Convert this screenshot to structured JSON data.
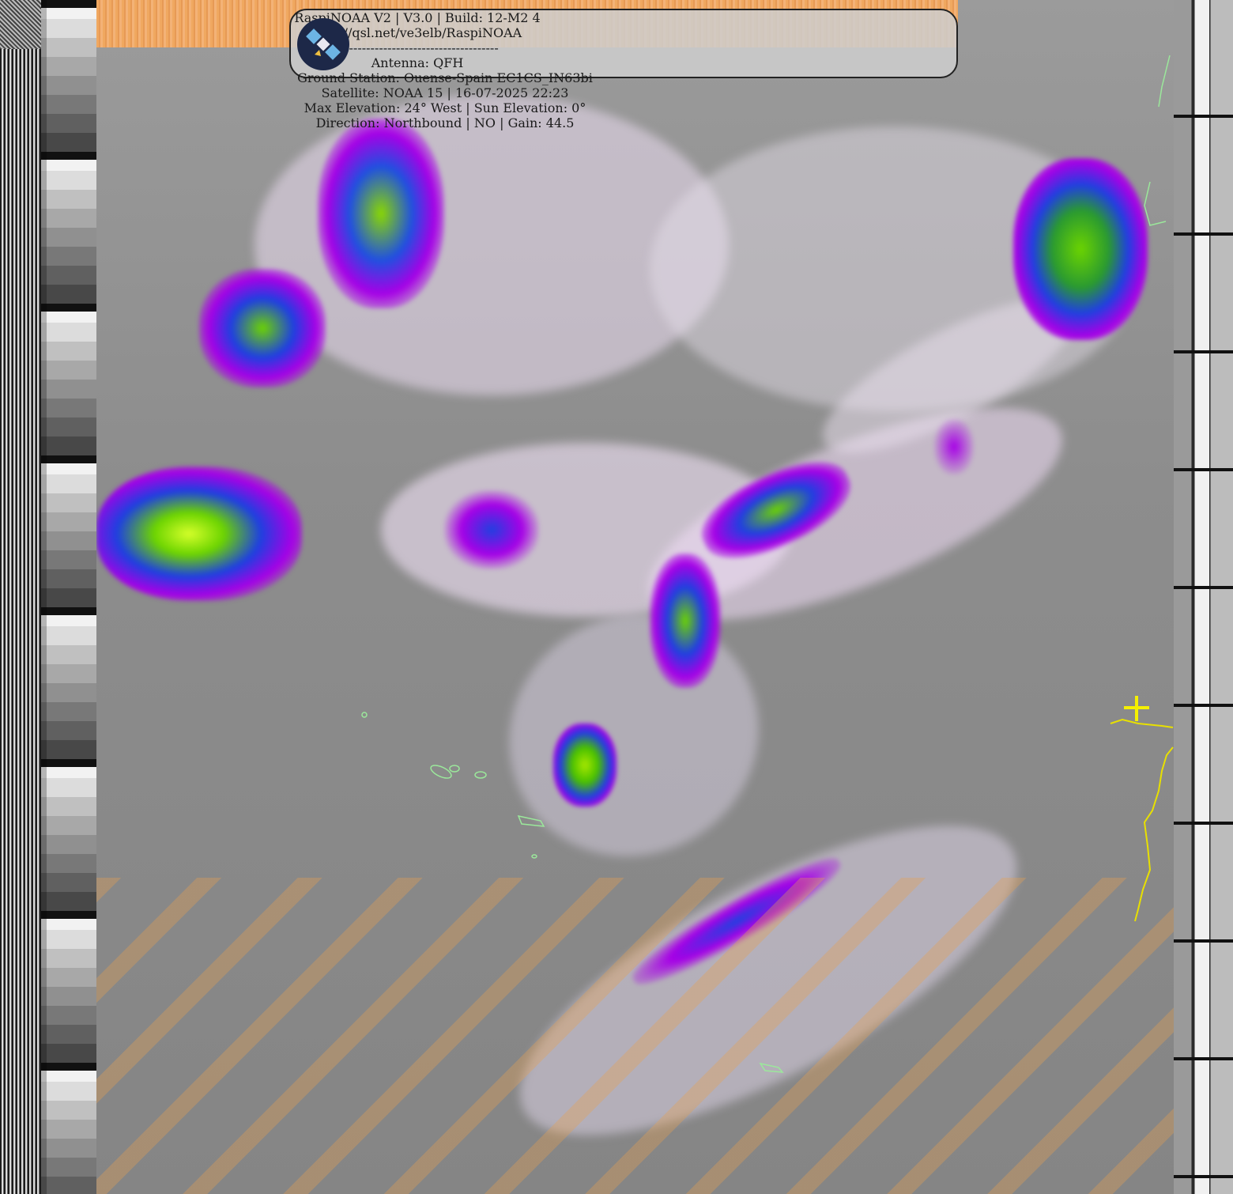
{
  "header": {
    "left": {
      "line1": "RaspiNOAA V2 | V3.0 | Build: 12-M2 4",
      "line2": "http://qsl.net/ve3elb/RaspiNOAA",
      "line3": "--------------------------------------",
      "line4": "Antenna: QFH"
    },
    "right": {
      "line1": "Ground Station: Ouense-Spain EC1CS_IN63bi",
      "line2": "Satellite: NOAA 15 | 16-07-2025 22:23",
      "line3": "Max Elevation: 24° West | Sun Elevation: 0°",
      "line4": "Direction: Northbound | NO | Gain: 44.5"
    }
  },
  "colors": {
    "orange_bar": "#f0a860",
    "coastline": "#e8e000",
    "island_outline": "#9be89b",
    "cloud_high": "#b000e0",
    "cloud_core": "#7ad000",
    "crosshair": "#f5f000"
  },
  "icons": {
    "logo": "satellite-logo-icon",
    "marker": "crosshair-marker-icon"
  }
}
